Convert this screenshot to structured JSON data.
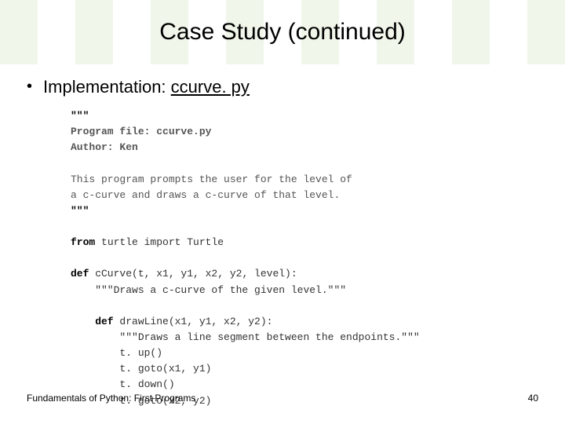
{
  "title": "Case Study (continued)",
  "bullet": {
    "label": "Implementation: ",
    "link": "ccurve. py"
  },
  "code": {
    "l1": "\"\"\"",
    "l2": "Program file: ccurve.py",
    "l3": "Author: Ken",
    "l4": "",
    "l5": "This program prompts the user for the level of",
    "l6": "a c-curve and draws a c-curve of that level.",
    "l7": "\"\"\"",
    "l8": "",
    "l9a": "from",
    "l9b": " turtle import Turtle",
    "l10": "",
    "l11a": "def",
    "l11b": " cCurve(t, x1, y1, x2, y2, level):",
    "l12": "    \"\"\"Draws a c-curve of the given level.\"\"\"",
    "l13": "",
    "l14a": "    def",
    "l14b": " drawLine(x1, y1, x2, y2):",
    "l15": "        \"\"\"Draws a line segment between the endpoints.\"\"\"",
    "l16": "        t. up()",
    "l17": "        t. goto(x1, y1)",
    "l18": "        t. down()",
    "l19": "        t. goto(x2, y2)"
  },
  "footer": {
    "left": "Fundamentals of Python: First Programs",
    "right": "40"
  }
}
